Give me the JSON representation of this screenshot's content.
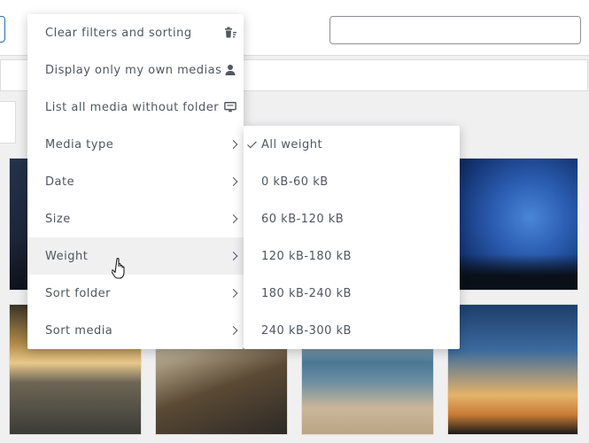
{
  "menu": {
    "items": [
      {
        "label": "Clear filters and sorting",
        "icon": "trash-filter-icon"
      },
      {
        "label": "Display only my own medias",
        "icon": "user-icon"
      },
      {
        "label": "List all media without folder",
        "icon": "monitor-list-icon"
      },
      {
        "label": "Media type",
        "icon": "chevron-right-icon"
      },
      {
        "label": "Date",
        "icon": "chevron-right-icon"
      },
      {
        "label": "Size",
        "icon": "chevron-right-icon"
      },
      {
        "label": "Weight",
        "icon": "chevron-right-icon"
      },
      {
        "label": "Sort folder",
        "icon": "chevron-right-icon"
      },
      {
        "label": "Sort media",
        "icon": "chevron-right-icon"
      }
    ]
  },
  "submenu": {
    "items": [
      {
        "label": "All weight",
        "selected": true
      },
      {
        "label": "0 kB-60 kB"
      },
      {
        "label": "60 kB-120 kB"
      },
      {
        "label": "120 kB-180 kB"
      },
      {
        "label": "180 kB-240 kB"
      },
      {
        "label": "240 kB-300 kB"
      }
    ]
  },
  "search": {
    "placeholder": ""
  },
  "colors": {
    "accent": "#2271b1",
    "menu_hover": "#f0f0f1",
    "text": "#50575e"
  }
}
